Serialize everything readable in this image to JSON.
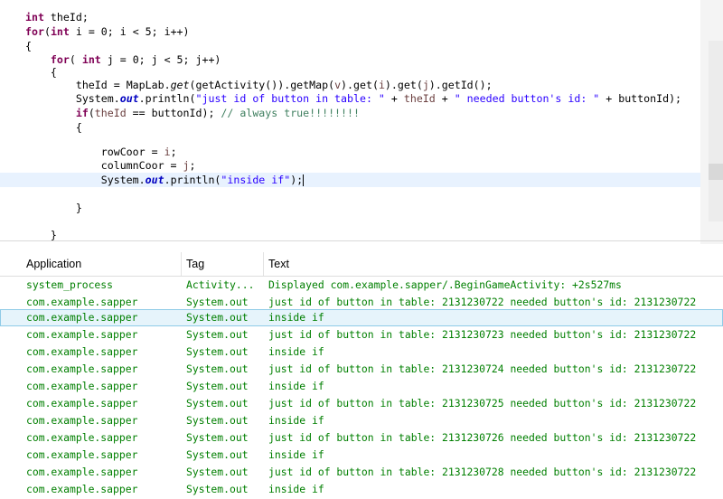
{
  "editor": {
    "l1_a": "int",
    "l1_b": " theId;",
    "l2_a": "for",
    "l2_b": "(",
    "l2_c": "int",
    "l2_d": " i = 0; i < 5; i++)",
    "l3": "{",
    "l4_a": "for",
    "l4_b": "( ",
    "l4_c": "int",
    "l4_d": " j = 0; j < 5; j++)",
    "l5": "{",
    "l6_a": "theId",
    "l6_b": " = MapLab.",
    "l6_c": "get",
    "l6_d": "(getActivity()).getMap(",
    "l6_e": "v",
    "l6_f": ").get(",
    "l6_g": "i",
    "l6_h": ").get(",
    "l6_i": "j",
    "l6_j": ").getId();",
    "l7_a": "System.",
    "l7_b": "out",
    "l7_c": ".println(",
    "l7_d": "\"just id of button in table: \"",
    "l7_e": " + ",
    "l7_f": "theId",
    "l7_g": " + ",
    "l7_h": "\" needed button's id: \"",
    "l7_i": " + ",
    "l7_j": "buttonId",
    "l7_k": ");",
    "l8_a": "if",
    "l8_b": "(",
    "l8_c": "theId",
    "l8_d": " == ",
    "l8_e": "buttonId",
    "l8_f": "); ",
    "l8_g": "// always true!!!!!!!!",
    "l9": "{",
    "l11_a": "rowCoor",
    "l11_b": " = ",
    "l11_c": "i",
    "l11_d": ";",
    "l12_a": "columnCoor",
    "l12_b": " = ",
    "l12_c": "j",
    "l12_d": ";",
    "l13_a": "System.",
    "l13_b": "out",
    "l13_c": ".println(",
    "l13_d": "\"inside if\"",
    "l13_e": ");",
    "l15": "}",
    "l17": "}"
  },
  "logcat": {
    "columns": {
      "application": "Application",
      "tag": "Tag",
      "text": "Text"
    },
    "rows": [
      {
        "app": "system_process",
        "tag": "Activity...",
        "text": "Displayed com.example.sapper/.BeginGameActivity: +2s527ms"
      },
      {
        "app": "com.example.sapper",
        "tag": "System.out",
        "text": "just id of button in table: 2131230722 needed button's id: 2131230722"
      },
      {
        "app": "com.example.sapper",
        "tag": "System.out",
        "text": "inside if"
      },
      {
        "app": "com.example.sapper",
        "tag": "System.out",
        "text": "just id of button in table: 2131230723 needed button's id: 2131230722"
      },
      {
        "app": "com.example.sapper",
        "tag": "System.out",
        "text": "inside if"
      },
      {
        "app": "com.example.sapper",
        "tag": "System.out",
        "text": "just id of button in table: 2131230724 needed button's id: 2131230722"
      },
      {
        "app": "com.example.sapper",
        "tag": "System.out",
        "text": "inside if"
      },
      {
        "app": "com.example.sapper",
        "tag": "System.out",
        "text": "just id of button in table: 2131230725 needed button's id: 2131230722"
      },
      {
        "app": "com.example.sapper",
        "tag": "System.out",
        "text": "inside if"
      },
      {
        "app": "com.example.sapper",
        "tag": "System.out",
        "text": "just id of button in table: 2131230726 needed button's id: 2131230722"
      },
      {
        "app": "com.example.sapper",
        "tag": "System.out",
        "text": "inside if"
      },
      {
        "app": "com.example.sapper",
        "tag": "System.out",
        "text": "just id of button in table: 2131230728 needed button's id: 2131230722"
      },
      {
        "app": "com.example.sapper",
        "tag": "System.out",
        "text": "inside if"
      }
    ]
  },
  "colors": {
    "keyword": "#7f0055",
    "string": "#2a00ff",
    "comment": "#3f7f5f",
    "local_var": "#6a3e3e",
    "static_field": "#0000c0",
    "log_text": "#007f00",
    "current_line": "#e8f2fe",
    "selected_row": "#e6f4fb"
  }
}
